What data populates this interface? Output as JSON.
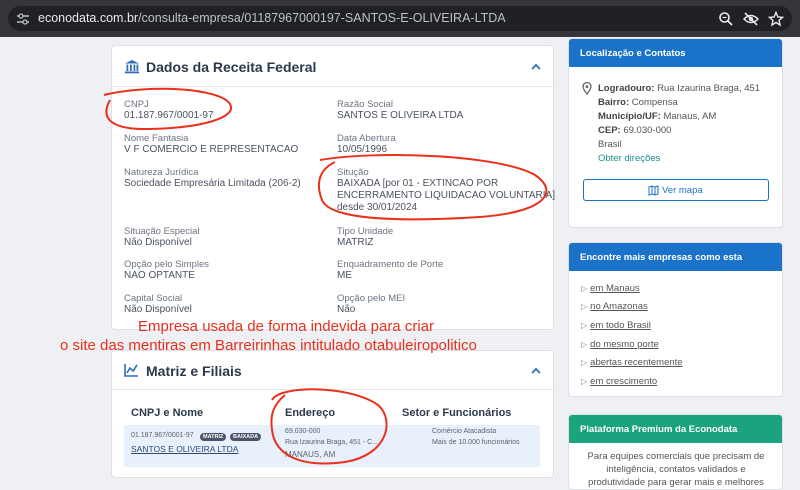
{
  "browser": {
    "url_host": "econodata.com.br",
    "url_path": "/consulta-empresa/01187967000197-SANTOS-E-OLIVEIRA-LTDA",
    "icons": [
      "tune-icon",
      "zoom-icon",
      "eye-off-icon",
      "star-icon"
    ]
  },
  "receita": {
    "title": "Dados da Receita Federal",
    "fields": {
      "cnpj_label": "CNPJ",
      "cnpj": "01.187.967/0001-97",
      "razao_label": "Razão Social",
      "razao": "SANTOS E OLIVEIRA LTDA",
      "fantasia_label": "Nome Fantasia",
      "fantasia": "V F COMERCIO E REPRESENTACAO",
      "abertura_label": "Data Abertura",
      "abertura": "10/05/1996",
      "natureza_label": "Natureza Jurídica",
      "natureza": "Sociedade Empresária Limitada (206-2)",
      "situacao_label": "Situção",
      "situacao_1": "BAIXADA [por 01 - EXTINCAO POR",
      "situacao_2": "ENCERRAMENTO LIQUIDACAO VOLUNTARIA]",
      "situacao_3": "desde 30/01/2024",
      "especial_label": "Situação Especial",
      "especial": "Não Disponível",
      "tipo_label": "Tipo Unidade",
      "tipo": "MATRIZ",
      "simples_label": "Opção pelo Simples",
      "simples": "NAO OPTANTE",
      "porte_label": "Enquadramento de Porte",
      "porte": "ME",
      "capital_label": "Capital Social",
      "capital": "Não Disponível",
      "mei_label": "Opção pelo MEI",
      "mei": "Não"
    }
  },
  "filiais": {
    "title": "Matriz e Filiais",
    "headers": [
      "CNPJ e Nome",
      "Endereço",
      "Setor e Funcionários"
    ],
    "row": {
      "cnpj": "01.187.967/0001-97",
      "badges": [
        "MATRIZ",
        "BAIXADA"
      ],
      "name": "SANTOS E OLIVEIRA LTDA",
      "cep": "69.030-000",
      "street": "Rua Izaurina Braga, 451 - C...",
      "city": "MANAUS, AM",
      "setor": "Comércio Atacadista",
      "funcionarios": "Mais de 10.000 funcionários"
    }
  },
  "localizacao": {
    "title": "Localização e Contatos",
    "logradouro_label": "Logradouro:",
    "logradouro": "Rua Izaurina Braga, 451",
    "bairro_label": "Bairro:",
    "bairro": "Compensa",
    "municipio_label": "Município/UF:",
    "municipio": "Manaus, AM",
    "cep_label": "CEP:",
    "cep": "69.030-000",
    "pais": "Brasil",
    "directions": "Obter direções",
    "map_button": "Ver mapa"
  },
  "mais_empresas": {
    "title": "Encontre mais empresas como esta",
    "items": [
      "em Manaus",
      "no Amazonas",
      "em todo Brasil",
      "do mesmo porte",
      "abertas recentemente",
      "em crescimento"
    ]
  },
  "premium": {
    "title": "Plataforma Premium da Econodata",
    "text_1": "Para equipes comerciais que precisam de",
    "text_2": "inteligência, contatos validados e",
    "text_3": "produtividade para gerar mais e melhores"
  },
  "annotation": {
    "line_1": "Empresa usada de forma indevida para criar",
    "line_2": "o site das mentiras em Barreirinhas intitulado otabuleiropolitico",
    "color": "#e8301c"
  }
}
